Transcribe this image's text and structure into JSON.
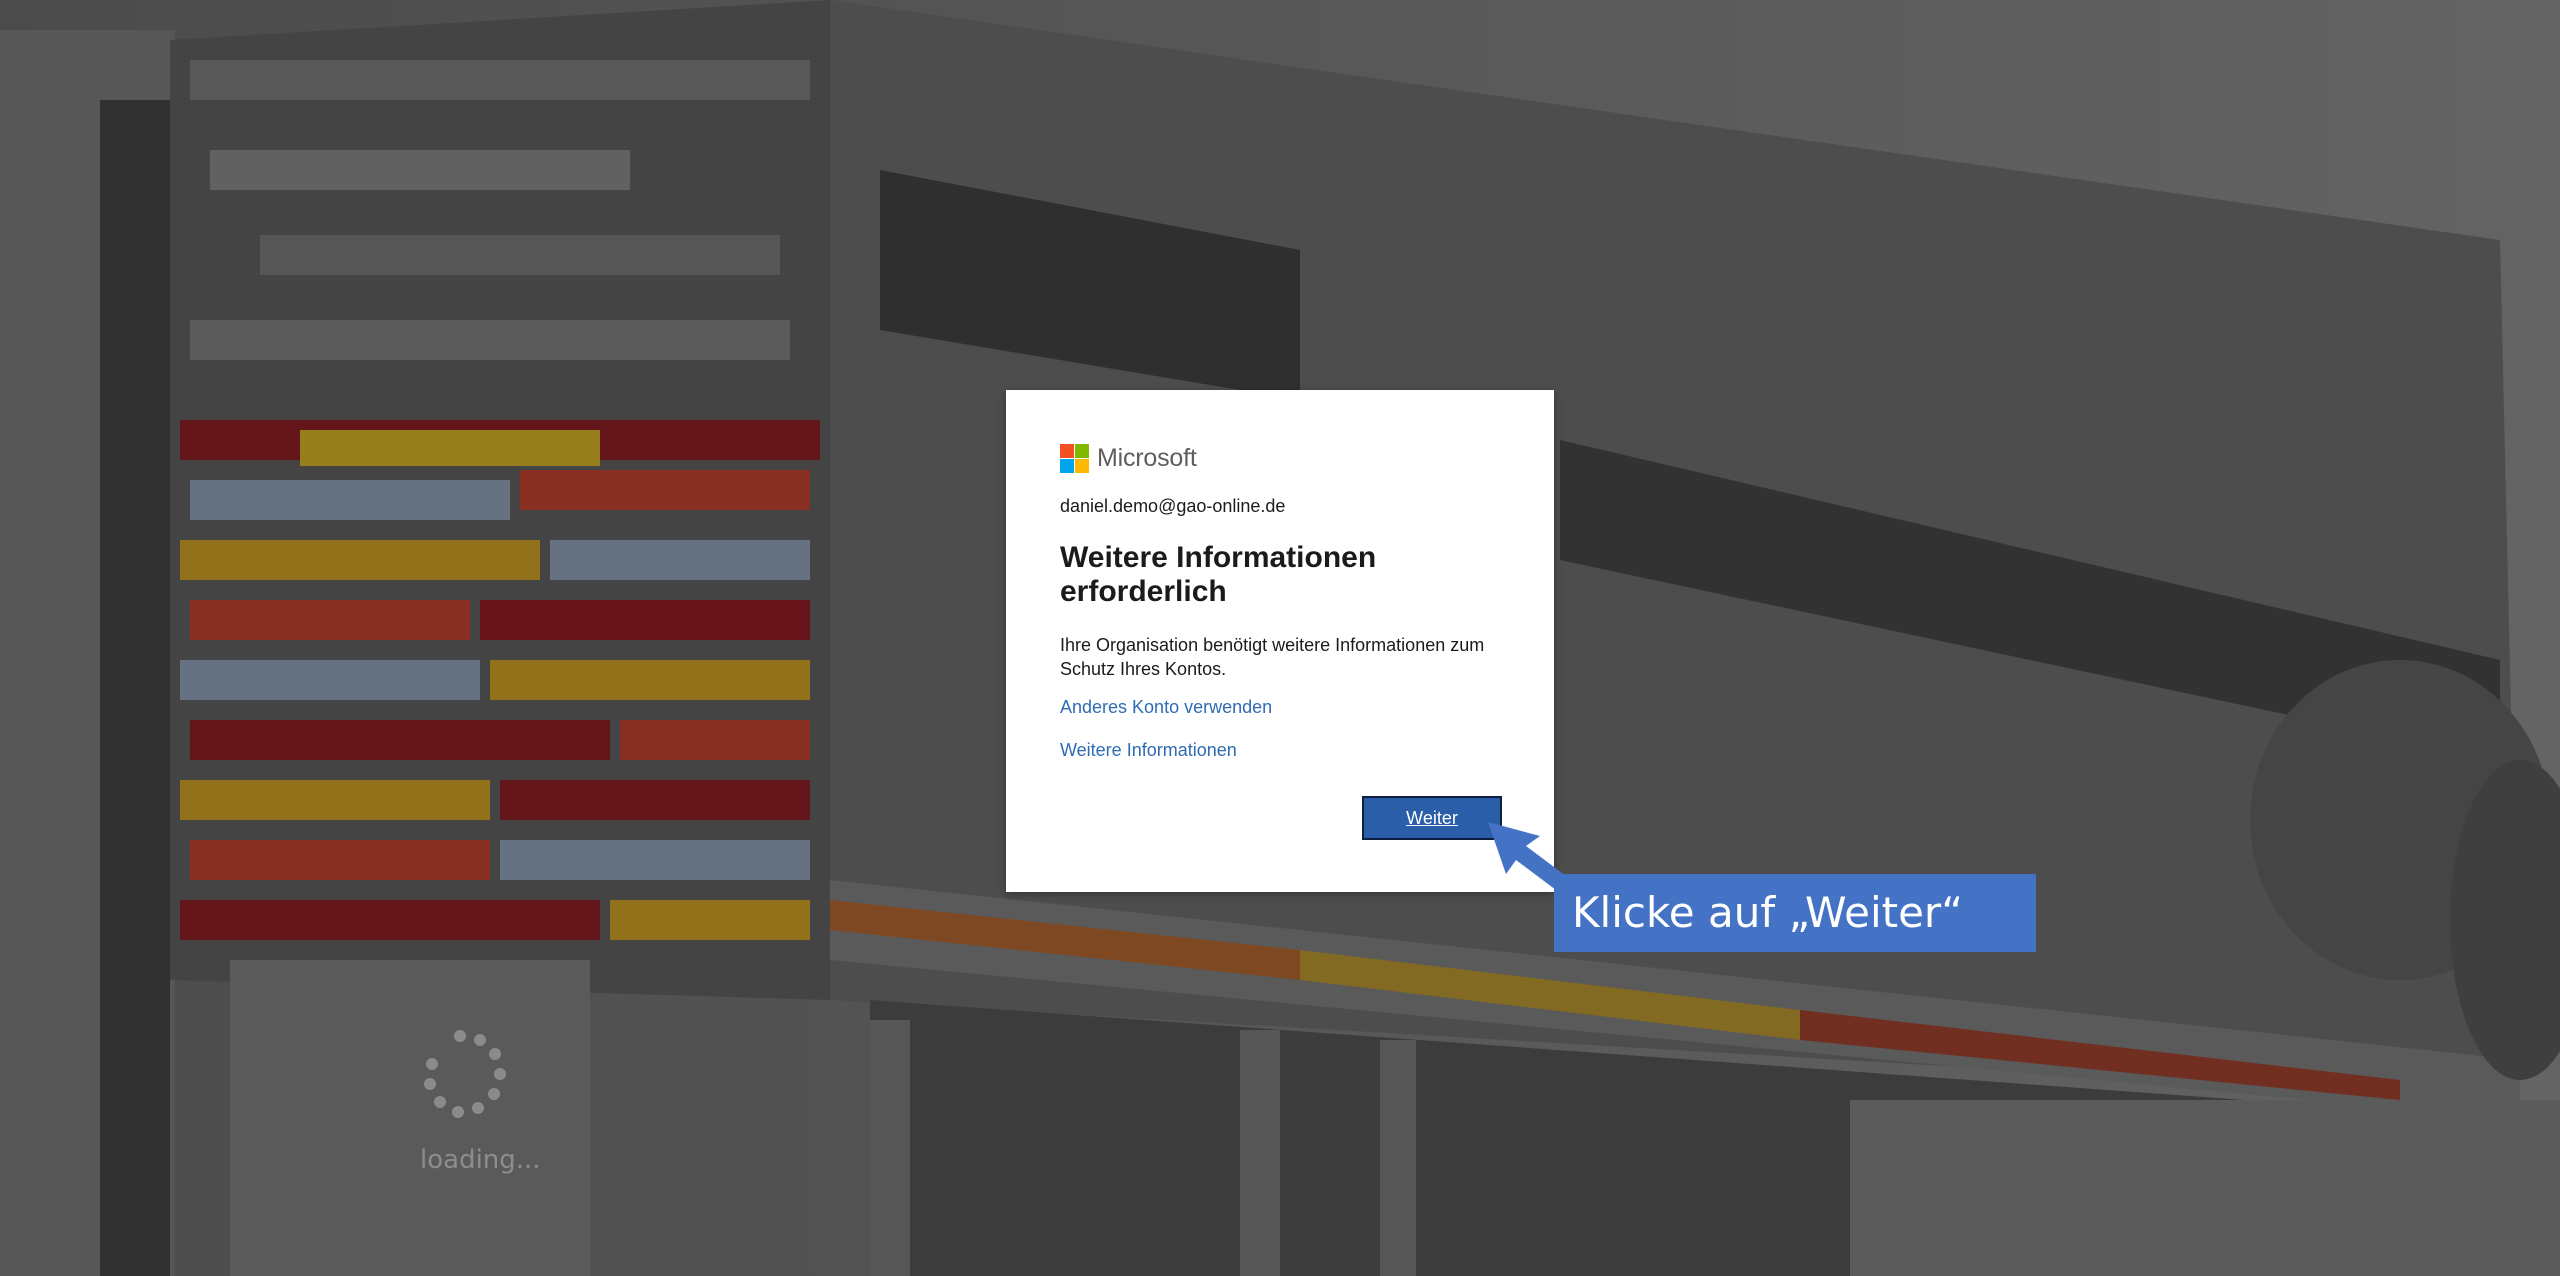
{
  "brand": {
    "name": "Microsoft",
    "logo_colors": [
      "#f25022",
      "#7fba00",
      "#00a4ef",
      "#ffb900"
    ]
  },
  "signin": {
    "account": "daniel.demo@gao-online.de",
    "title": "Weitere Informationen erforderlich",
    "description": "Ihre Organisation benötigt weitere Informationen zum Schutz Ihres Kontos.",
    "link_other_account": "Anderes Konto verwenden",
    "link_more_info": "Weitere Informationen",
    "next_button": "Weiter"
  },
  "callout": {
    "text": "Klicke auf „Weiter“"
  },
  "loader": {
    "text": "loading..."
  },
  "colors": {
    "accent": "#2b5ea8",
    "link": "#2f6bb5",
    "callout": "#4472c4"
  }
}
